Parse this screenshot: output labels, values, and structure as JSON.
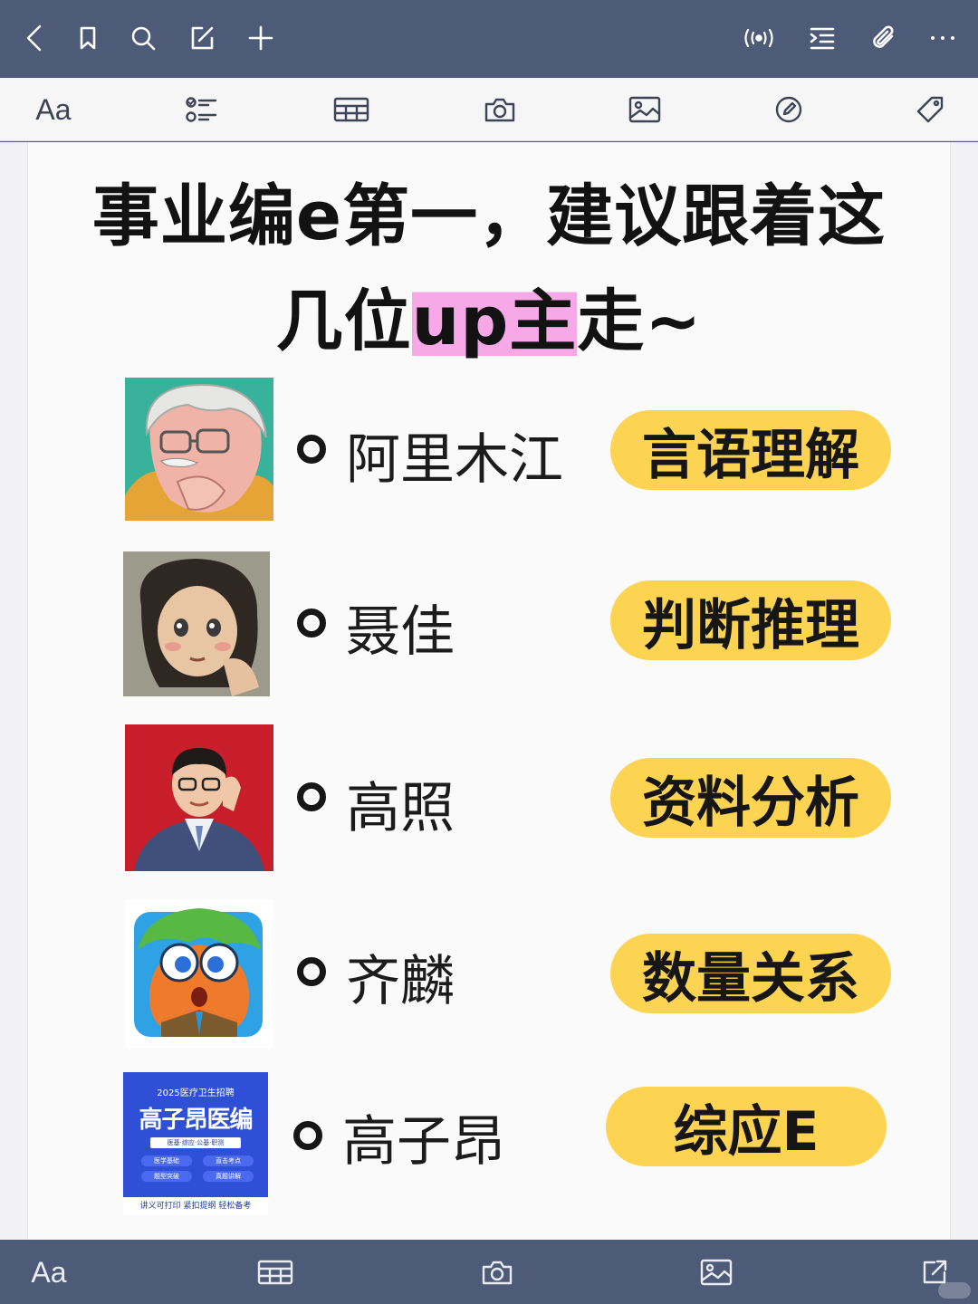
{
  "top_nav": {
    "icons": [
      "back-arrow-icon",
      "bookmark-icon",
      "search-icon",
      "edit-icon",
      "plus-icon",
      "broadcast-icon",
      "outline-list-icon",
      "paperclip-icon",
      "more-icon"
    ]
  },
  "toolbar": {
    "font_label": "Aa",
    "icons": [
      "checklist-icon",
      "table-icon",
      "camera-icon",
      "image-icon",
      "pen-circle-icon",
      "tag-icon"
    ]
  },
  "note": {
    "title_line1": "事业编e第一，建议跟着这",
    "title_line2_before": "几位",
    "title_line2_highlight": "up主",
    "title_line2_after": "走~",
    "highlight_color": "#f7a8e6",
    "pill_color": "#fcd452",
    "rows": [
      {
        "name": "阿里木江",
        "subject": "言语理解",
        "avatar": "old-man-cartoon-avatar"
      },
      {
        "name": "聂佳",
        "subject": "判断推理",
        "avatar": "girl-painting-avatar"
      },
      {
        "name": "高照",
        "subject": "资料分析",
        "avatar": "man-in-suit-photo-avatar"
      },
      {
        "name": "齐麟",
        "subject": "数量关系",
        "avatar": "cartoon-mascot-avatar"
      },
      {
        "name": "高子昂",
        "subject": "综应E",
        "avatar": "course-cover-avatar"
      }
    ],
    "cover": {
      "year_line": "2025医疗卫生招聘",
      "brand": "高子昂医编",
      "sub": "医基·综应·公基·职测",
      "tags": [
        "医学基础",
        "直击考点",
        "题型突破",
        "真题讲解"
      ],
      "footer": "讲义可打印 紧扣提纲 轻松备考"
    }
  },
  "bottom_bar": {
    "font_label": "Aa",
    "icons": [
      "table-icon",
      "camera-icon",
      "image-icon",
      "share-icon"
    ]
  }
}
